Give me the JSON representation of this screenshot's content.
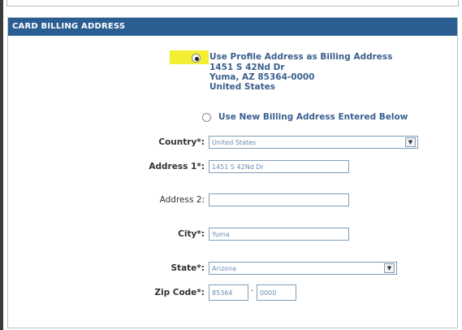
{
  "section_title": "CARD BILLING ADDRESS",
  "profile_option": {
    "label": "Use Profile Address as Billing Address",
    "address_line1": "1451 S 42Nd Dr",
    "address_line2": "Yuma, AZ 85364-0000",
    "address_line3": "United States",
    "selected": true
  },
  "new_option": {
    "label": "Use New Billing Address Entered Below",
    "selected": false
  },
  "form": {
    "country_label": "Country*:",
    "country_value": "United States",
    "address1_label": "Address 1*:",
    "address1_value": "1451 S 42Nd Dr",
    "address2_label": "Address 2:",
    "address2_value": "",
    "city_label": "City*:",
    "city_value": "Yuma",
    "state_label": "State*:",
    "state_value": "Arizona",
    "zip_label": "Zip Code*:",
    "zip_value": "85364",
    "zip_ext_value": "0000",
    "zip_separator": "-"
  },
  "colors": {
    "header": "#2a5e92",
    "highlight": "#f3ee31",
    "text_blue": "#3a5f8f"
  }
}
